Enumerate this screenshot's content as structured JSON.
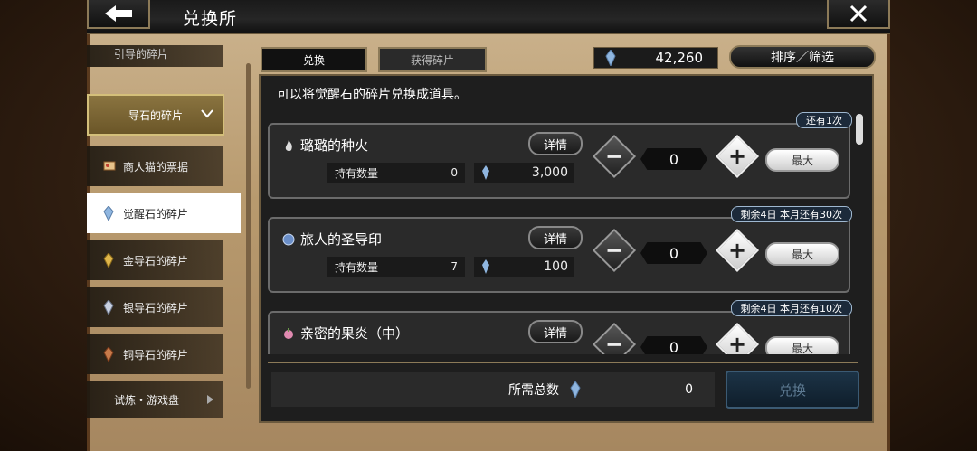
{
  "header": {
    "title": "兑换所"
  },
  "sidebar": {
    "items": [
      {
        "label": "引导的碎片"
      },
      {
        "label": "导石的碎片"
      },
      {
        "label": "商人猫的票据"
      },
      {
        "label": "觉醒石的碎片"
      },
      {
        "label": "金导石的碎片"
      },
      {
        "label": "银导石的碎片"
      },
      {
        "label": "铜导石的碎片"
      },
      {
        "label": "试炼・游戏盘"
      }
    ]
  },
  "tabs": [
    {
      "label": "兑换"
    },
    {
      "label": "获得碎片"
    }
  ],
  "currency": {
    "value": "42,260"
  },
  "sort_button": {
    "label": "排序／筛选"
  },
  "description": "可以将觉醒石的碎片兑换成道具。",
  "items": [
    {
      "name": "璐璐的种火",
      "badge": "还有1次",
      "detail": "详情",
      "held_label": "持有数量",
      "held": "0",
      "cost": "3,000",
      "qty": "0",
      "max": "最大"
    },
    {
      "name": "旅人的圣导印",
      "badge": "剩余4日  本月还有30次",
      "detail": "详情",
      "held_label": "持有数量",
      "held": "7",
      "cost": "100",
      "qty": "0",
      "max": "最大"
    },
    {
      "name": "亲密的果炎（中）",
      "badge": "剩余4日  本月还有10次",
      "detail": "详情",
      "held_label": "持有数量",
      "held": "",
      "cost": "",
      "qty": "0",
      "max": "最大"
    }
  ],
  "total": {
    "label": "所需总数",
    "value": "0"
  },
  "exchange_button": {
    "label": "兑换"
  },
  "colors": {
    "accent_gold": "#d4bf7a",
    "crystal": "#8fb6e0",
    "disabled_button": "#1c3346"
  }
}
